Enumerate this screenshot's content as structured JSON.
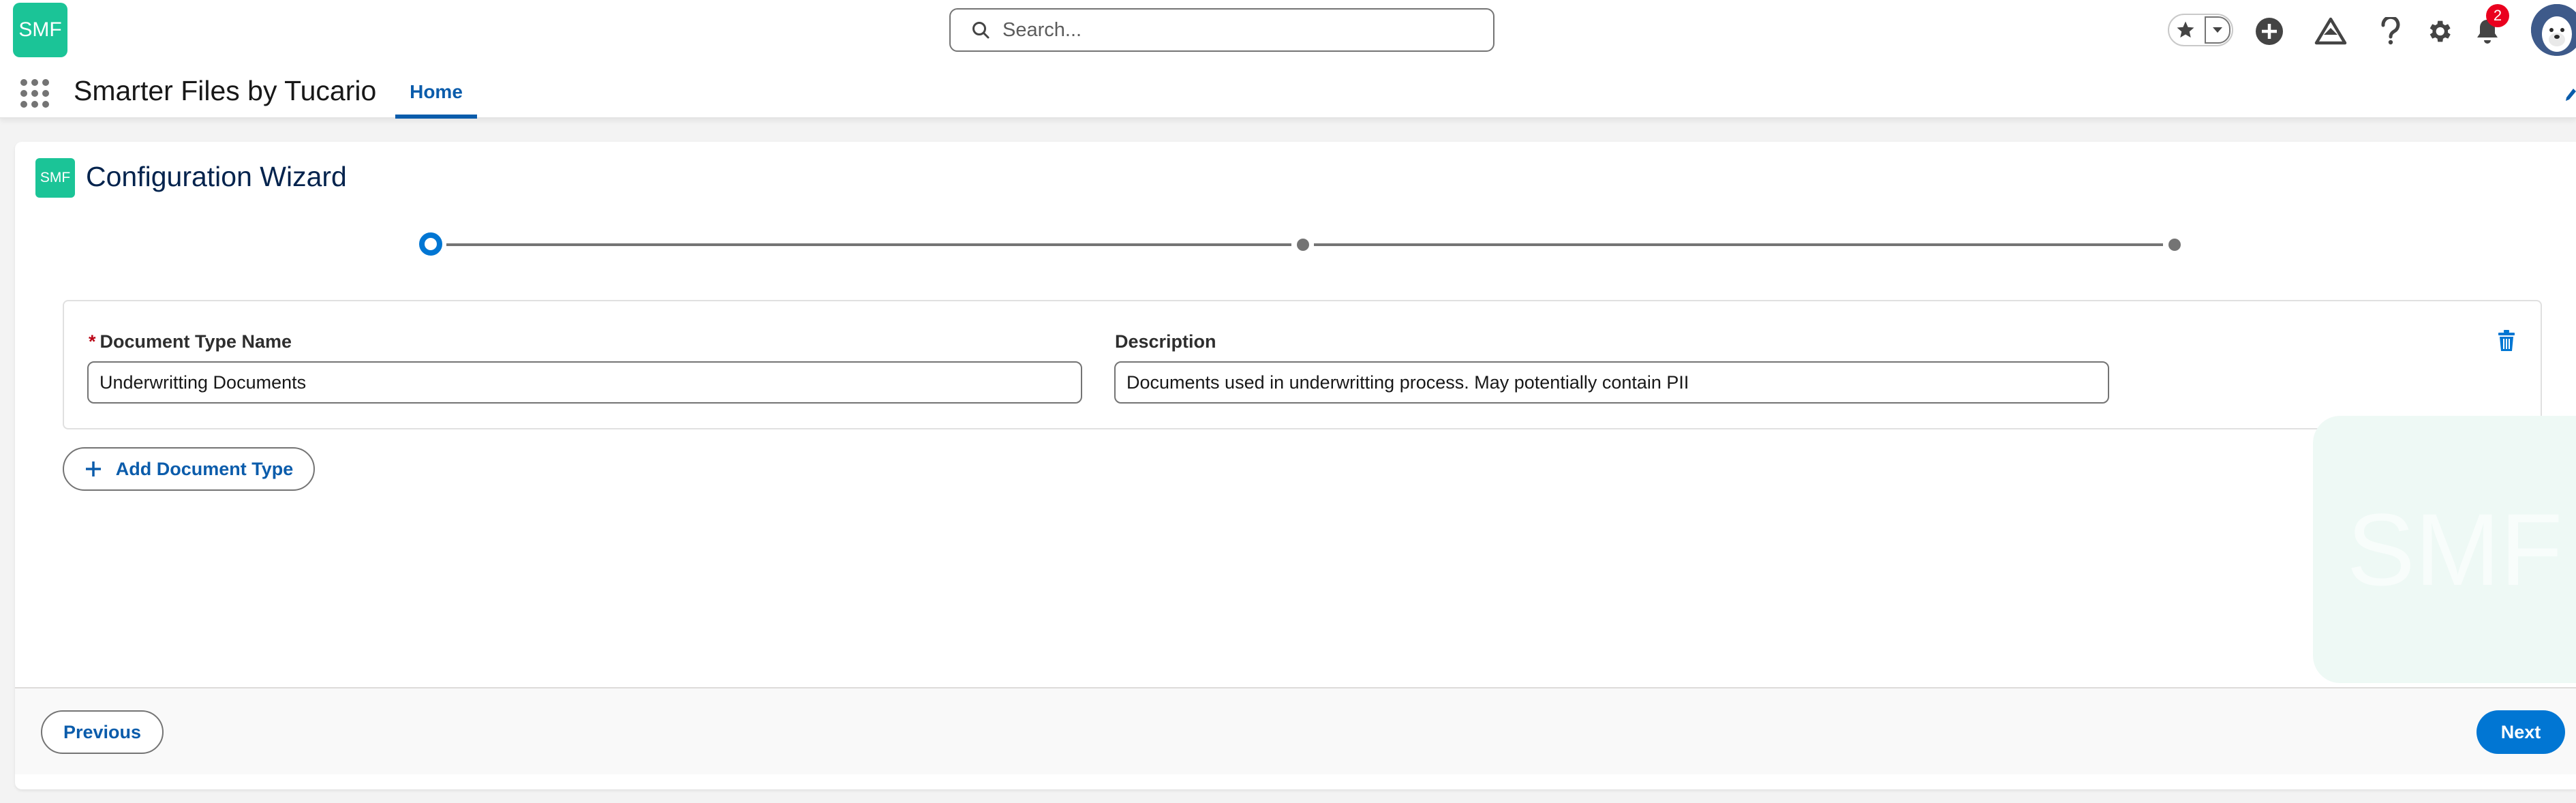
{
  "header": {
    "logo_text": "SMF",
    "search_placeholder": "Search...",
    "notification_count": "2",
    "icons": [
      "star-icon",
      "chevron-down-icon",
      "add-icon",
      "trailhead-icon",
      "help-icon",
      "gear-icon",
      "bell-icon"
    ]
  },
  "nav": {
    "app_name": "Smarter Files by Tucario",
    "tabs": [
      {
        "label": "Home",
        "active": true
      }
    ]
  },
  "wizard": {
    "logo_text": "SMF",
    "title": "Configuration Wizard",
    "steps_total": 3,
    "current_step": 1,
    "document_types": [
      {
        "name_label": "Document Type Name",
        "name_required": "*",
        "name_value": "Underwritting Documents",
        "description_label": "Description",
        "description_value": "Documents used in underwritting process. May potentially contain PII"
      }
    ],
    "add_button_label": "Add Document Type",
    "watermark_text": "SMF",
    "previous_label": "Previous",
    "next_label": "Next"
  },
  "colors": {
    "brand_green": "#1bc497",
    "primary_blue": "#0176d3",
    "link_blue": "#0b5cab",
    "required_red": "#ba0517",
    "badge_red": "#ea001e"
  }
}
